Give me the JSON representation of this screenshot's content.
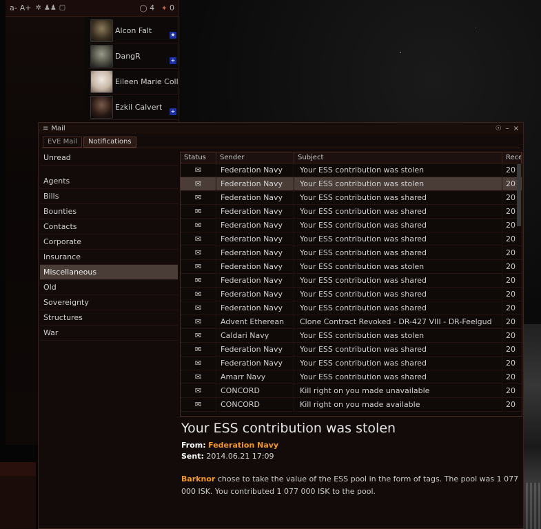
{
  "chat": {
    "toolbar": {
      "font_smaller": "a-",
      "font_larger": "A+",
      "docked_count": "4",
      "member_count": "0"
    },
    "members": [
      {
        "name": "Alcon Falt",
        "standing": "★",
        "standing_color": "#1b2fa6"
      },
      {
        "name": "DangR",
        "standing": "+",
        "standing_color": "#1b2fa6"
      },
      {
        "name": "Eileen Marie Coll",
        "standing": "",
        "standing_color": ""
      },
      {
        "name": "Ezkil Calvert",
        "standing": "+",
        "standing_color": "#1b2fa6"
      }
    ]
  },
  "mail": {
    "title": "Mail",
    "tabs": [
      {
        "label": "EVE Mail"
      },
      {
        "label": "Notifications"
      }
    ],
    "folders": [
      "Unread",
      "Agents",
      "Bills",
      "Bounties",
      "Contacts",
      "Corporate",
      "Insurance",
      "Miscellaneous",
      "Old",
      "Sovereignty",
      "Structures",
      "War"
    ],
    "selected_folder": "Miscellaneous",
    "columns": {
      "status": "Status",
      "sender": "Sender",
      "subject": "Subject",
      "received": "Rece"
    },
    "rows": [
      {
        "sender": "Federation Navy",
        "subject": "Your ESS contribution was stolen",
        "received": "20"
      },
      {
        "sender": "Federation Navy",
        "subject": "Your ESS contribution was stolen",
        "received": "20"
      },
      {
        "sender": "Federation Navy",
        "subject": "Your ESS contribution was shared",
        "received": "20"
      },
      {
        "sender": "Federation Navy",
        "subject": "Your ESS contribution was shared",
        "received": "20"
      },
      {
        "sender": "Federation Navy",
        "subject": "Your ESS contribution was shared",
        "received": "20"
      },
      {
        "sender": "Federation Navy",
        "subject": "Your ESS contribution was shared",
        "received": "20"
      },
      {
        "sender": "Federation Navy",
        "subject": "Your ESS contribution was shared",
        "received": "20"
      },
      {
        "sender": "Federation Navy",
        "subject": "Your ESS contribution was stolen",
        "received": "20"
      },
      {
        "sender": "Federation Navy",
        "subject": "Your ESS contribution was shared",
        "received": "20"
      },
      {
        "sender": "Federation Navy",
        "subject": "Your ESS contribution was shared",
        "received": "20"
      },
      {
        "sender": "Federation Navy",
        "subject": "Your ESS contribution was shared",
        "received": "20"
      },
      {
        "sender": "Advent Etherean",
        "subject": "Clone Contract Revoked - DR-427 VIII - DR-Feelgud",
        "received": "20"
      },
      {
        "sender": "Caldari Navy",
        "subject": "Your ESS contribution was stolen",
        "received": "20"
      },
      {
        "sender": "Federation Navy",
        "subject": "Your ESS contribution was shared",
        "received": "20"
      },
      {
        "sender": "Federation Navy",
        "subject": "Your ESS contribution was shared",
        "received": "20"
      },
      {
        "sender": "Amarr Navy",
        "subject": "Your ESS contribution was shared",
        "received": "20"
      },
      {
        "sender": "CONCORD",
        "subject": "Kill right on you made unavailable",
        "received": "20"
      },
      {
        "sender": "CONCORD",
        "subject": "Kill right on you made available",
        "received": "20"
      }
    ],
    "selected_row_index": 1,
    "reader": {
      "subject": "Your ESS contribution was stolen",
      "from_label": "From:",
      "from": "Federation Navy",
      "sent_label": "Sent:",
      "sent": "2014.06.21 17:09",
      "actor": "Barknor",
      "body": "chose to take the value of the ESS pool in the form of tags. The pool was 1 077 000 ISK. You contributed 1 077 000 ISK to the pool."
    }
  }
}
